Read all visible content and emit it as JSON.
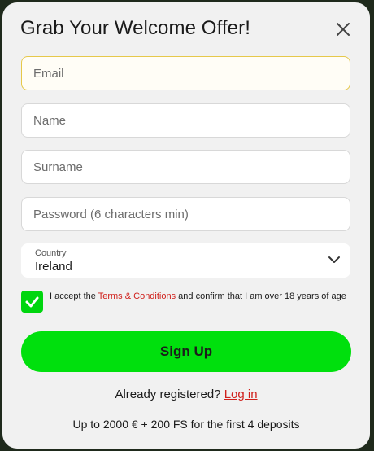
{
  "modal": {
    "title": "Grab Your Welcome Offer!",
    "close_icon": "close-icon"
  },
  "form": {
    "email": {
      "placeholder": "Email",
      "value": ""
    },
    "name": {
      "placeholder": "Name",
      "value": ""
    },
    "surname": {
      "placeholder": "Surname",
      "value": ""
    },
    "password": {
      "placeholder": "Password (6 characters min)",
      "value": ""
    },
    "country": {
      "label": "Country",
      "value": "Ireland",
      "icon": "chevron-down-icon"
    },
    "terms": {
      "checked": true,
      "prefix": "I accept the ",
      "link": "Terms & Conditions",
      "suffix": " and confirm that I am over 18 years of age"
    },
    "submit_label": "Sign Up"
  },
  "footer": {
    "already_registered": "Already registered?",
    "login_link": "Log in",
    "bonus_text": "Up to 2000 € + 200 FS for the first 4 deposits"
  },
  "colors": {
    "accent_green": "#00e00d",
    "link_red": "#d0201c",
    "focus_border": "#e6c84a",
    "modal_bg": "#f1f1f1"
  }
}
